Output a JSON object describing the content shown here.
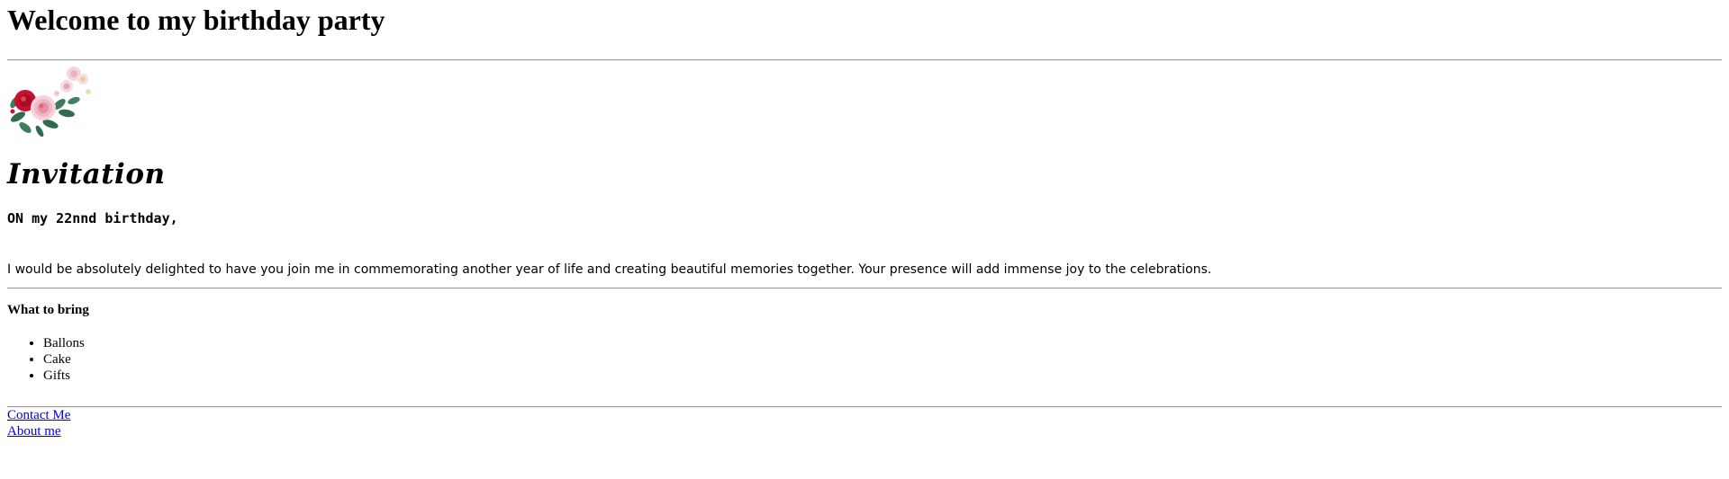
{
  "header": {
    "title": "Welcome to my birthday party"
  },
  "invitation": {
    "title": "Invitation",
    "birthday_line": "ON my 22nnd birthday,",
    "message": "I would be absolutely delighted to have you join me in commemorating another year of life and creating beautiful memories together. Your presence will add immense joy to the celebrations.",
    "image_icon": "flower-bouquet-icon"
  },
  "bring": {
    "heading": "What to bring",
    "items": [
      {
        "label": "Ballons"
      },
      {
        "label": "Cake"
      },
      {
        "label": "Gifts"
      }
    ]
  },
  "links": [
    {
      "label": "Contact Me"
    },
    {
      "label": "About me"
    }
  ],
  "colors": {
    "link": "#0000ee",
    "rule": "#9a9a9a",
    "rose_red": "#c8102e",
    "rose_pink": "#f3c1cc",
    "leaf": "#2f6b4f"
  }
}
